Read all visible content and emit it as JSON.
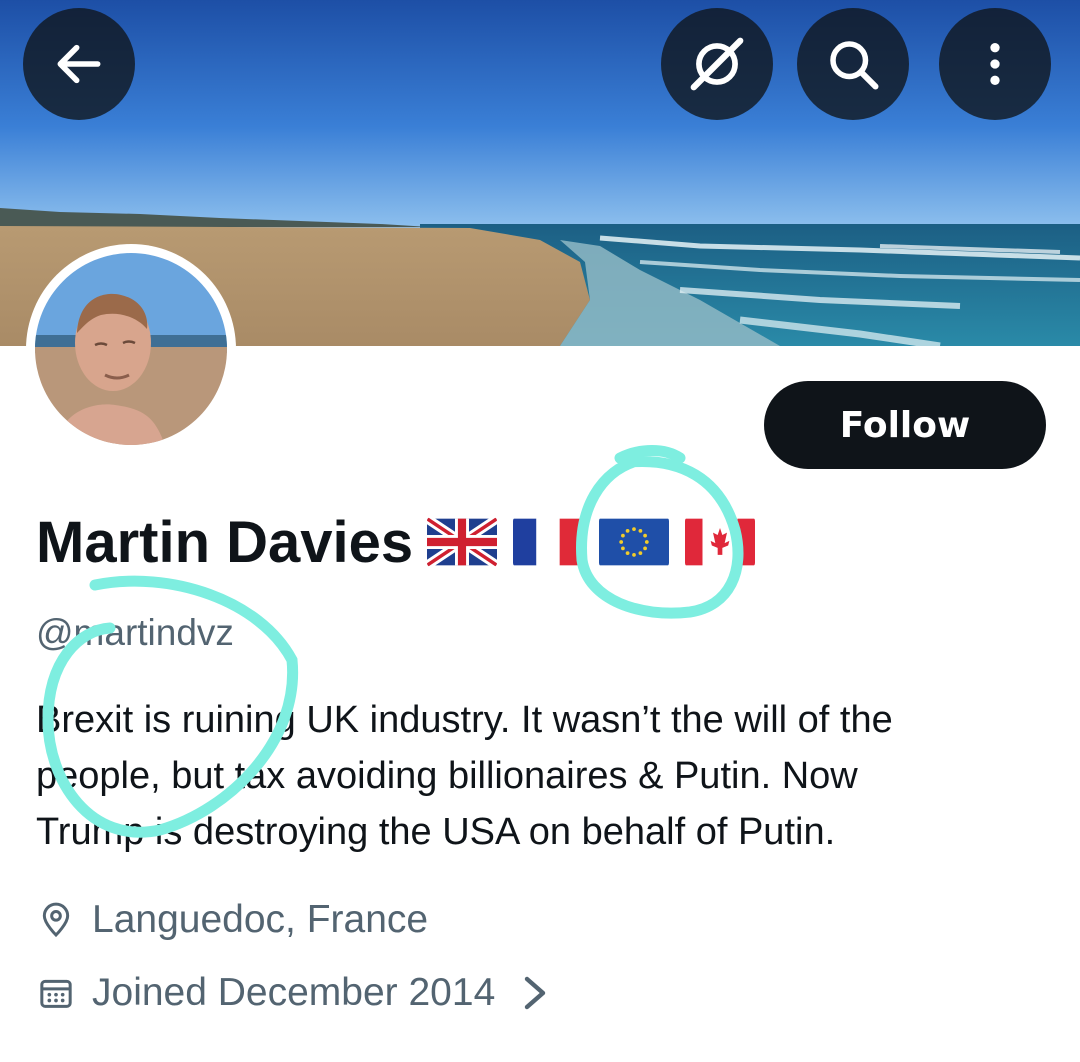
{
  "profile": {
    "display_name": "Martin Davies",
    "flags": [
      "uk-flag",
      "france-flag",
      "eu-flag",
      "canada-flag"
    ],
    "handle": "@martindvz",
    "bio": "Brexit is ruining UK industry. It wasn’t the will of the\npeople, but tax avoiding billionaires &  Putin. Now\nTrump is destroying the USA  on behalf of Putin.",
    "location": "Languedoc, France",
    "joined": "Joined December 2014"
  },
  "actions": {
    "follow_label": "Follow"
  },
  "header": {
    "icons": [
      "back-arrow-icon",
      "grok-icon",
      "search-icon",
      "more-icon"
    ]
  },
  "colors": {
    "primary_text": "#0f1419",
    "secondary_text": "#536471",
    "follow_bg": "#0f1419",
    "annotation": "#7eeee0"
  }
}
